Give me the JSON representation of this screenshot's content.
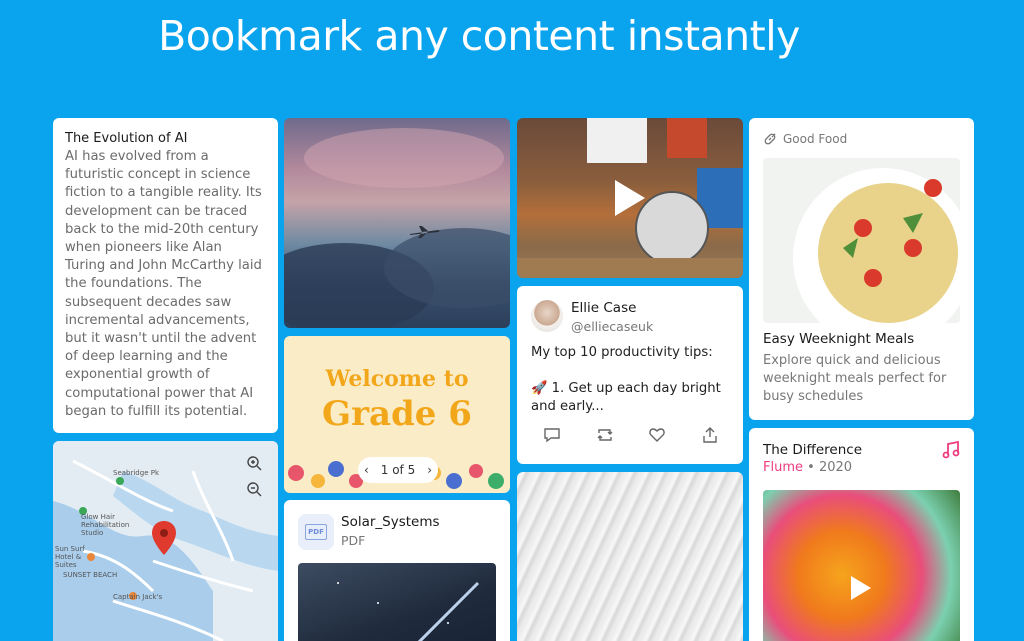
{
  "headline": "Bookmark any content instantly",
  "article": {
    "title": "The Evolution of AI",
    "body": "AI has evolved from a futuristic concept in science fiction to a tangible reality. Its development can be traced back to the mid-20th century when pioneers like Alan Turing and John McCarthy laid the foundations. The subsequent decades saw incremental advancements, but it wasn't until the advent of deep learning and the exponential growth of computational power that AI began to fulfill its potential."
  },
  "map": {
    "labels": [
      "Seabridge Pk",
      "Glow Hair Rehabilitation Studio",
      "Sun Surf Hotel & Suites",
      "SUNSET BEACH",
      "Captain Jack's"
    ]
  },
  "welcome": {
    "line1": "Welcome to",
    "line2": "Grade 6",
    "pager": "1 of 5"
  },
  "pdf": {
    "name": "Solar_Systems",
    "type": "PDF",
    "icon_label": "PDF"
  },
  "tweet": {
    "name": "Ellie Case",
    "handle": "@elliecaseuk",
    "text": "My top 10 productivity tips:\n\n🚀 1. Get up each day bright and early..."
  },
  "food": {
    "source": "Good Food",
    "title": "Easy Weeknight Meals",
    "description": "Explore quick and delicious weeknight meals perfect for busy schedules"
  },
  "music": {
    "title": "The Difference",
    "artist": "Flume",
    "separator": " • ",
    "year": "2020"
  },
  "colors": {
    "background": "#0aa3ee",
    "accent_pink": "#ec3d80",
    "welcome_yellow": "#f2a71b"
  }
}
